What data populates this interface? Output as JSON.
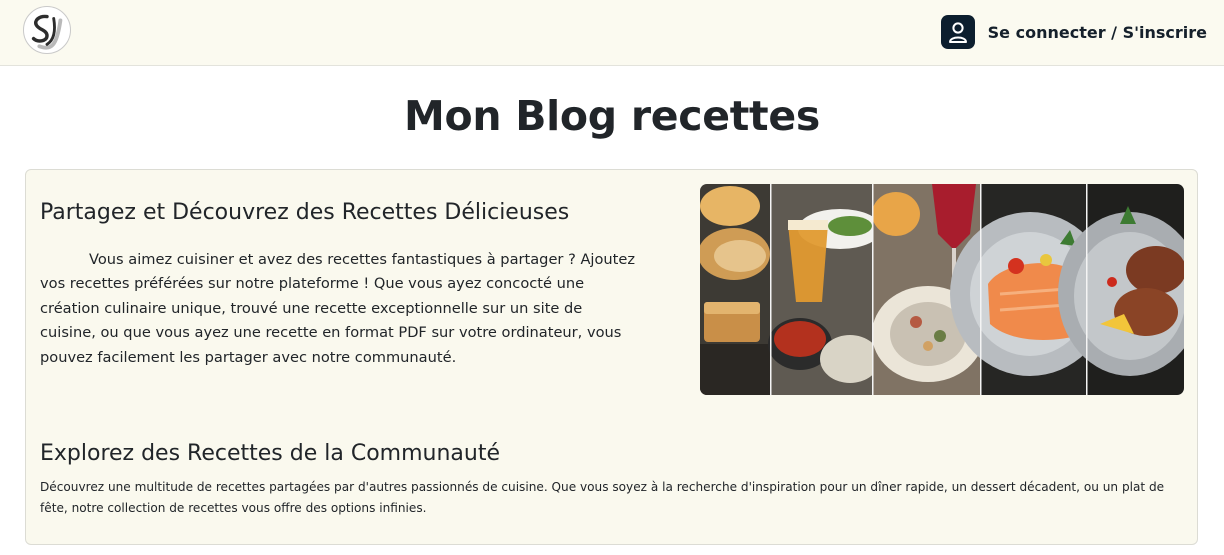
{
  "header": {
    "logo_icon": "sj-logo",
    "login_icon": "user-icon",
    "login_label": "Se connecter / S'inscrire"
  },
  "page": {
    "title": "Mon Blog recettes"
  },
  "intro": {
    "heading": "Partagez et Découvrez des Recettes Délicieuses",
    "body": "Vous aimez cuisiner et avez des recettes fantastiques à partager ? Ajoutez vos recettes préférées sur notre plateforme ! Que vous ayez concocté une création culinaire unique, trouvé une recette exceptionnelle sur un site de cuisine, ou que vous ayez une recette en format PDF sur votre ordinateur, vous pouvez facilement les partager avec notre communauté."
  },
  "explore": {
    "heading": "Explorez des Recettes de la Communauté",
    "body": "Découvrez une multitude de recettes partagées par d'autres passionnés de cuisine. Que vous soyez à la recherche d'inspiration pour un dîner rapide, un dessert décadent, ou un plat de fête, notre collection de recettes vous offre des options infinies."
  },
  "colors": {
    "header_bg": "#fbfaf0",
    "card_bg": "#faf9ee",
    "icon_bg": "#0c1e2e",
    "text": "#212529"
  }
}
